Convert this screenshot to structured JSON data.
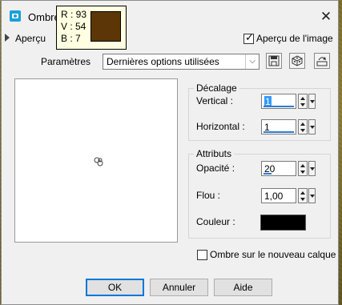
{
  "window": {
    "title": "Ombre",
    "icon": "camera-app-icon",
    "close_icon": "close-icon"
  },
  "color_picker": {
    "r": "R : 93",
    "v": "V : 54",
    "b": "B : 7",
    "swatch_color": "#5d3607"
  },
  "preview": {
    "expander_label": "Aperçu",
    "image_preview_label": "Aperçu de l'image",
    "image_preview_checked": true
  },
  "params": {
    "label": "Paramètres",
    "preset_value": "Dernières options utilisées",
    "buttons": [
      "save-icon",
      "randomize-icon",
      "manage-presets-icon"
    ]
  },
  "decalage": {
    "title": "Décalage",
    "vertical_label": "Vertical :",
    "vertical_value": "1",
    "horizontal_label": "Horizontal :",
    "horizontal_value": "1"
  },
  "attributs": {
    "title": "Attributs",
    "opacite_label": "Opacité :",
    "opacite_value": "20",
    "flou_label": "Flou :",
    "flou_value": "1,00",
    "couleur_label": "Couleur :",
    "couleur_color": "#000000"
  },
  "shadow_layer": {
    "label": "Ombre sur le nouveau calque",
    "checked": false
  },
  "buttons": {
    "ok": "OK",
    "cancel": "Annuler",
    "help": "Aide"
  },
  "colors": {
    "accent": "#0078d7",
    "dialog_bg": "#f0f0f0"
  }
}
